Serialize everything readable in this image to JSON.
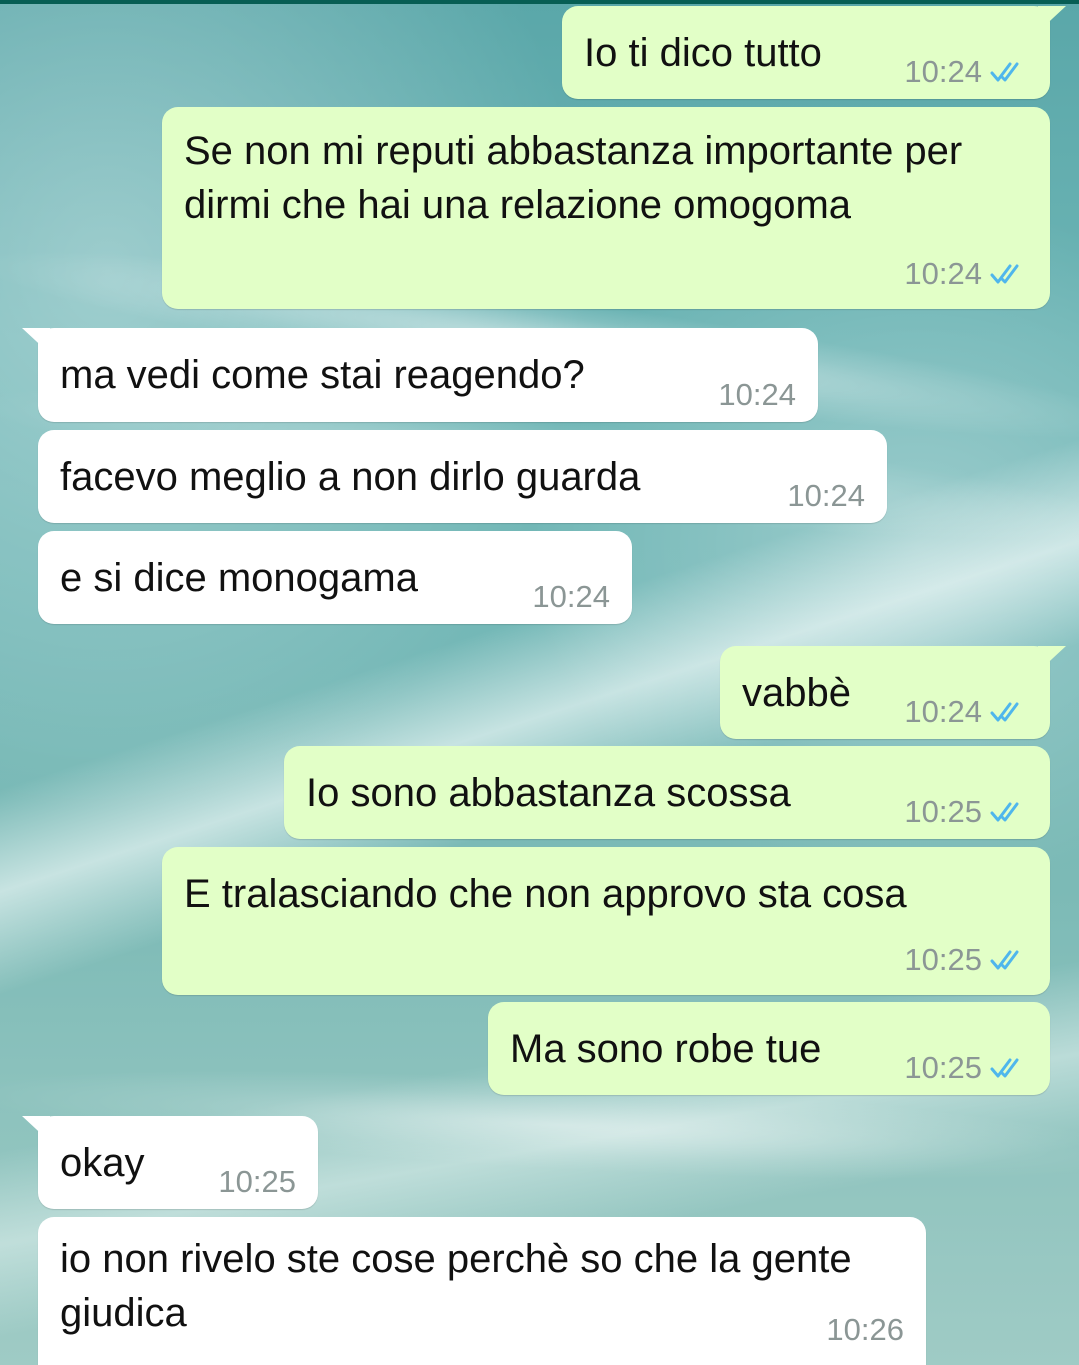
{
  "messages": [
    {
      "direction": "out",
      "text": "Io ti dico tutto",
      "time": "10:24",
      "status": "read"
    },
    {
      "direction": "out",
      "text": "Se non mi reputi abbastanza importante per dirmi che hai una relazione omogoma",
      "time": "10:24",
      "status": "read"
    },
    {
      "direction": "in",
      "text": "ma vedi come stai reagendo?",
      "time": "10:24"
    },
    {
      "direction": "in",
      "text": "facevo meglio a non dirlo guarda",
      "time": "10:24"
    },
    {
      "direction": "in",
      "text": "e si dice monogama",
      "time": "10:24"
    },
    {
      "direction": "out",
      "text": "vabbè",
      "time": "10:24",
      "status": "read"
    },
    {
      "direction": "out",
      "text": "Io sono abbastanza scossa",
      "time": "10:25",
      "status": "read"
    },
    {
      "direction": "out",
      "text": "E tralasciando che non approvo sta cosa",
      "time": "10:25",
      "status": "read"
    },
    {
      "direction": "out",
      "text": "Ma sono robe tue",
      "time": "10:25",
      "status": "read"
    },
    {
      "direction": "in",
      "text": "okay",
      "time": "10:25"
    },
    {
      "direction": "in",
      "text": "io non rivelo ste cose perchè so che la gente giudica",
      "time": "10:26"
    }
  ],
  "colors": {
    "outgoing_bubble": "#e2ffc7",
    "incoming_bubble": "#ffffff",
    "read_tick": "#4fb6ec",
    "timestamp": "#8b9695"
  }
}
